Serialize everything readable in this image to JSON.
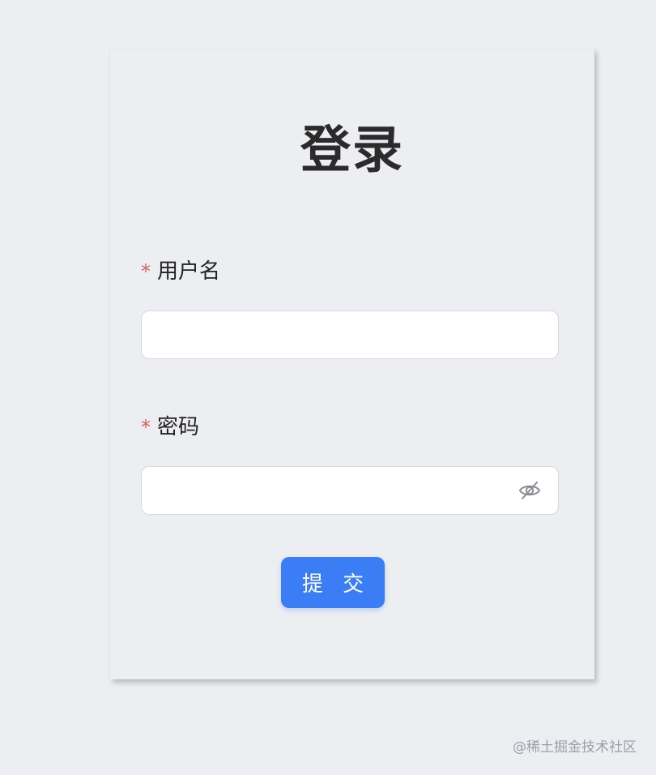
{
  "login_form": {
    "title": "登录",
    "username": {
      "required_mark": "*",
      "label": "用户名",
      "value": "",
      "placeholder": ""
    },
    "password": {
      "required_mark": "*",
      "label": "密码",
      "value": "",
      "placeholder": "",
      "toggle_icon": "eye-off-icon"
    },
    "submit_label": "提 交"
  },
  "watermark": "@稀土掘金技术社区",
  "colors": {
    "background": "#eceef2",
    "primary": "#3a7df5",
    "required": "#e05a5a",
    "title": "#2b2b2b"
  }
}
